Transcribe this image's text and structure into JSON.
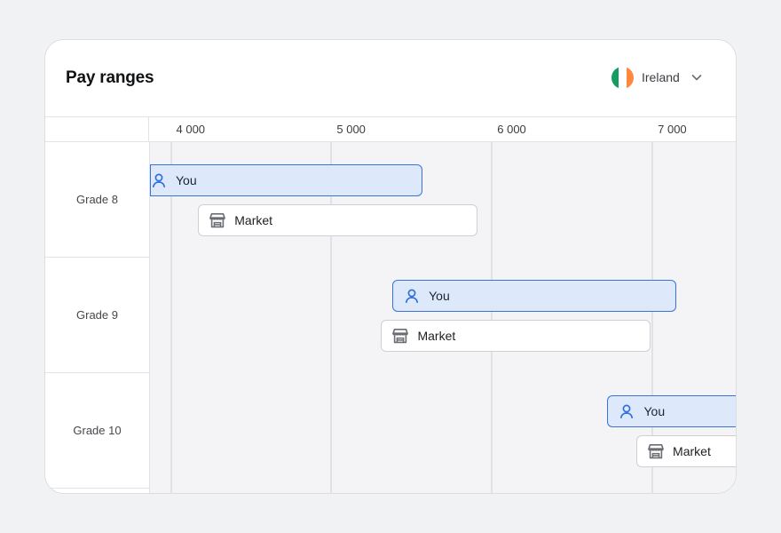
{
  "header": {
    "title": "Pay ranges",
    "country": {
      "name": "Ireland",
      "flag_colors": [
        "#169b62",
        "#ffffff",
        "#ff883e"
      ]
    }
  },
  "colors": {
    "you_fill": "#dde9fb",
    "you_border": "#3a73d8",
    "you_icon": "#2f6fdb",
    "market_fill": "#ffffff",
    "market_border": "#cfd0d4",
    "market_icon": "#6b6d73"
  },
  "chart_data": {
    "type": "bar",
    "orientation": "horizontal-range",
    "x_ticks": [
      {
        "value": 4000,
        "label": "4 000"
      },
      {
        "value": 5000,
        "label": "5 000"
      },
      {
        "value": 6000,
        "label": "6 000"
      },
      {
        "value": 7000,
        "label": "7 000"
      }
    ],
    "xlim": [
      3870,
      7530
    ],
    "grid": true,
    "categories": [
      "Grade 8",
      "Grade 9",
      "Grade 10"
    ],
    "series": [
      {
        "name": "You",
        "icon": "user-icon",
        "ranges": [
          [
            3870,
            5570
          ],
          [
            5380,
            7150
          ],
          [
            6720,
            7530
          ]
        ]
      },
      {
        "name": "Market",
        "icon": "store-icon",
        "ranges": [
          [
            4170,
            5910
          ],
          [
            5310,
            6990
          ],
          [
            6900,
            7530
          ]
        ]
      }
    ]
  }
}
